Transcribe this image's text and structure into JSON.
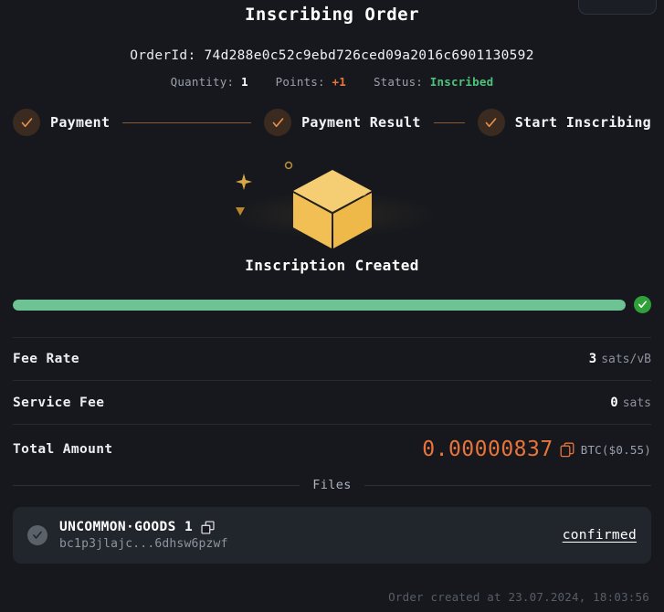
{
  "header": {
    "title": "Inscribing Order",
    "order_id_label": "OrderId:",
    "order_id_value": "74d288e0c52c9ebd726ced09a2016c6901130592",
    "meta": [
      {
        "label": "Quantity:",
        "value": "1",
        "tone": "plain"
      },
      {
        "label": "Points:",
        "value": "+1",
        "tone": "points"
      },
      {
        "label": "Status:",
        "value": "Inscribed",
        "tone": "status"
      }
    ]
  },
  "stepper": {
    "steps": [
      {
        "label": "Payment",
        "state": "done"
      },
      {
        "label": "Payment Result",
        "state": "done"
      },
      {
        "label": "Start Inscribing",
        "state": "done"
      }
    ]
  },
  "graphic": {
    "icon": "cube-icon",
    "caption": "Inscription Created"
  },
  "progress": {
    "percent": 100,
    "complete_icon": "check-circle-icon"
  },
  "fees": [
    {
      "label": "Fee Rate",
      "value": "3",
      "unit": "sats/vB"
    },
    {
      "label": "Service Fee",
      "value": "0",
      "unit": "sats"
    }
  ],
  "total": {
    "label": "Total Amount",
    "amount": "0.00000837",
    "copy_icon": "copy-icon",
    "unit": "BTC($0.55)"
  },
  "files_section": {
    "divider_label": "Files",
    "items": [
      {
        "name": "UNCOMMON·GOODS 1",
        "copy_icon": "copy-icon",
        "address": "bc1p3jlajc...6dhsw6pzwf",
        "status": "confirmed",
        "check_icon": "check-icon"
      }
    ]
  },
  "footer": {
    "created_text": "Order created at 23.07.2024, 18:03:56"
  },
  "colors": {
    "background": "#16181d",
    "accent_orange": "#e8743a",
    "progress_green": "#6dc394",
    "status_green": "#4ec27a",
    "cube_gold": "#f0c061",
    "step_line": "#8a5a34"
  }
}
